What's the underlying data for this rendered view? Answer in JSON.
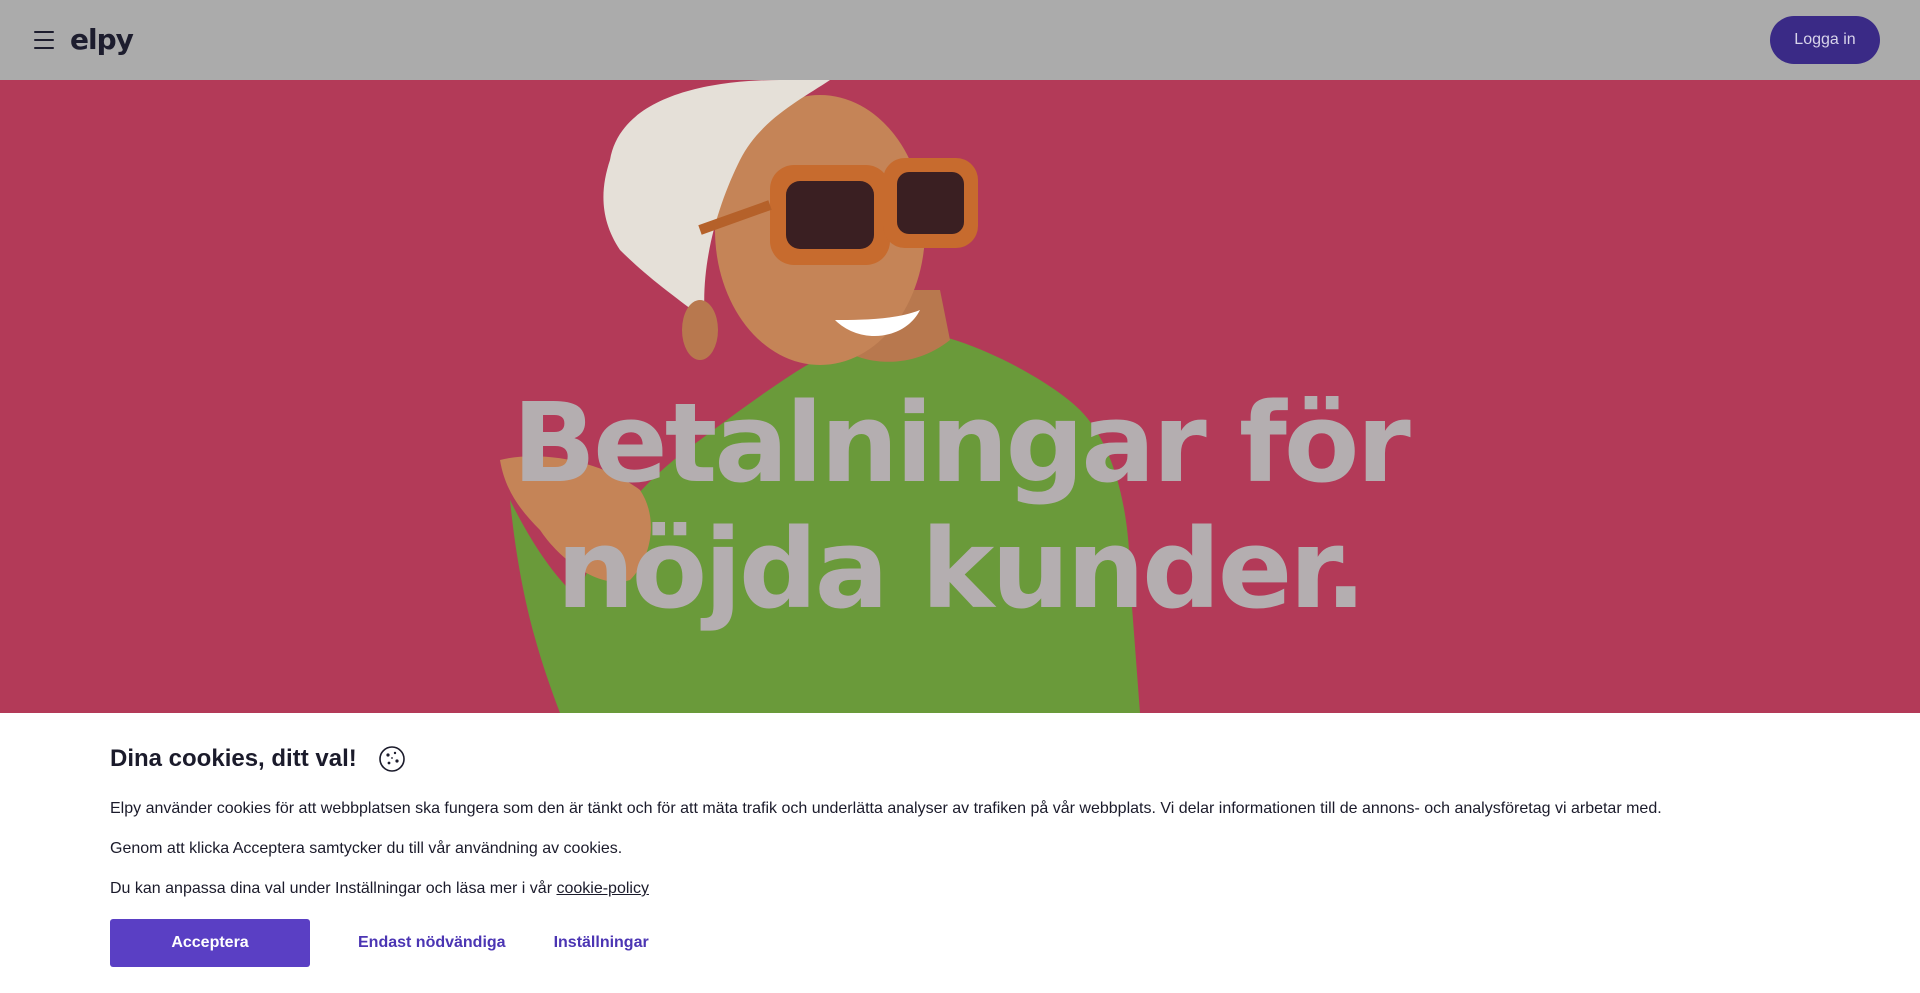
{
  "header": {
    "logo_text": "elpy",
    "login_label": "Logga in"
  },
  "hero": {
    "title_line1": "Betalningar för",
    "title_line2": "nöjda kunder."
  },
  "cookie_banner": {
    "title": "Dina cookies, ditt val!",
    "text1": "Elpy använder cookies för att webbplatsen ska fungera som den är tänkt och för att mäta trafik och underlätta analyser av trafiken på vår webbplats. Vi delar informationen till de annons- och analysföretag vi arbetar med.",
    "text2": "Genom att klicka Acceptera samtycker du till vår användning av cookies.",
    "text3_prefix": "Du kan anpassa dina val under Inställningar och läsa mer i vår ",
    "policy_link": "cookie-policy",
    "accept_label": "Acceptera",
    "necessary_label": "Endast nödvändiga",
    "settings_label": "Inställningar"
  },
  "icons": {
    "menu": "hamburger-menu-icon",
    "cookie": "cookie-icon"
  },
  "colors": {
    "header_bg": "#ababab",
    "hero_bg": "#b33a58",
    "accent": "#5a3fc4",
    "login_bg": "#3a2a86",
    "sweater": "#6a9a3a"
  }
}
